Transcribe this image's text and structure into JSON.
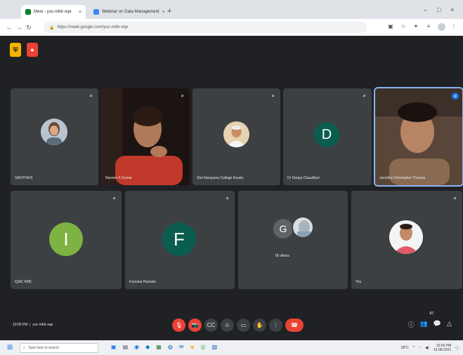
{
  "browser": {
    "tabs": [
      {
        "label": "Meet - yuc-mbtr-xqe",
        "active": true
      },
      {
        "label": "Webinar on Data Management",
        "active": false
      }
    ],
    "new_tab": "+",
    "url": "https://meet.google.com/yuc-mbtr-xqe",
    "window_controls": [
      "–",
      "□",
      "×"
    ]
  },
  "meet": {
    "top_icons": [
      {
        "name": "shield-icon",
        "glyph": "🛡",
        "color": "#f4b400"
      },
      {
        "name": "recording-icon",
        "glyph": "●",
        "color": "#ea4335"
      }
    ],
    "participants_row1": [
      {
        "name": "SAVITHA B",
        "kind": "photo",
        "color": "#9aa7b3"
      },
      {
        "name": "Naveen K Kumar",
        "kind": "video",
        "color": "#7a2e26"
      },
      {
        "name": "Shri Narayana College Kerala",
        "kind": "photo",
        "color": "#c9a97a"
      },
      {
        "name": "Dr Deepa Chaudhari",
        "kind": "letter",
        "letter": "D",
        "color": "#0b5e4f"
      },
      {
        "name": "Jacintha Christopher Thomas",
        "kind": "video",
        "color": "#6b4a3a",
        "speaking": true
      }
    ],
    "participants_row2": [
      {
        "name": "IQAC KMC",
        "kind": "letter",
        "letter": "I",
        "color": "#7cb342"
      },
      {
        "name": "Farzana Hussain",
        "kind": "letter",
        "letter": "F",
        "color": "#0b5e4f"
      },
      {
        "name": "78 others",
        "kind": "group",
        "letter": "G",
        "color": "#5f6368"
      },
      {
        "name": "You",
        "kind": "photo",
        "color": "#f1f3f4"
      }
    ],
    "clock": "10:05 PM",
    "meeting_code": "yuc-mbtr-xqe",
    "controls": [
      {
        "name": "mic-off-button",
        "glyph": "🎙",
        "red": true
      },
      {
        "name": "camera-off-button",
        "glyph": "📷",
        "red": true
      },
      {
        "name": "captions-button",
        "glyph": "CC",
        "red": false
      },
      {
        "name": "emoji-button",
        "glyph": "☺",
        "red": false
      },
      {
        "name": "present-button",
        "glyph": "▭",
        "red": false
      },
      {
        "name": "raise-hand-button",
        "glyph": "✋",
        "red": false
      },
      {
        "name": "more-options-button",
        "glyph": "⋮",
        "red": false
      }
    ],
    "end_call_glyph": "☎",
    "right_controls": [
      "ⓘ",
      "👥",
      "💬",
      "△"
    ],
    "people_count": "82"
  },
  "taskbar": {
    "start_glyph": "⊞",
    "search_placeholder": "Type here to search",
    "apps": [
      "▣",
      "▤",
      "◉",
      "◆",
      "▦",
      "◍",
      "✉",
      "◈",
      "◎",
      "▧"
    ],
    "weather": "28°C",
    "time": "10:05 PM",
    "date": "12-08-2021"
  }
}
